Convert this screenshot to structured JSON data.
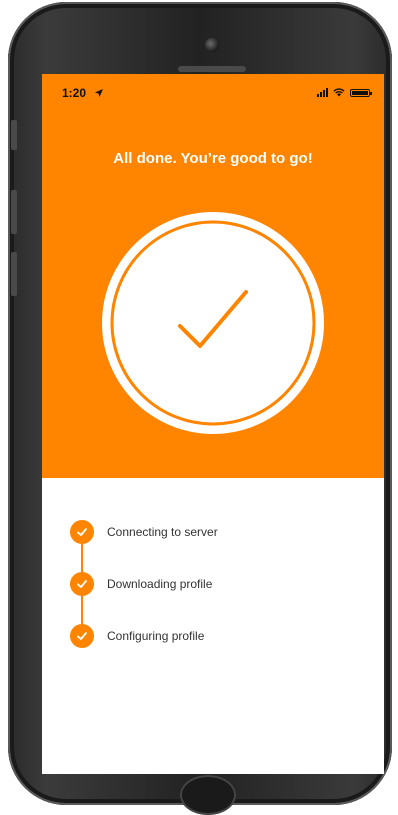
{
  "colors": {
    "accent": "#ff8400",
    "screen_bg": "#ffffff",
    "text_dark": "#333333",
    "text_light": "#ffffff"
  },
  "status_bar": {
    "time": "1:20",
    "icons": [
      "location-arrow-icon",
      "signal-icon",
      "wifi-icon",
      "battery-icon"
    ]
  },
  "hero": {
    "title": "All done. You’re good to go!",
    "icon": "checkmark-icon"
  },
  "steps": [
    {
      "label": "Connecting to server",
      "icon": "check-circle-icon"
    },
    {
      "label": "Downloading profile",
      "icon": "check-circle-icon"
    },
    {
      "label": "Configuring profile",
      "icon": "check-circle-icon"
    }
  ]
}
